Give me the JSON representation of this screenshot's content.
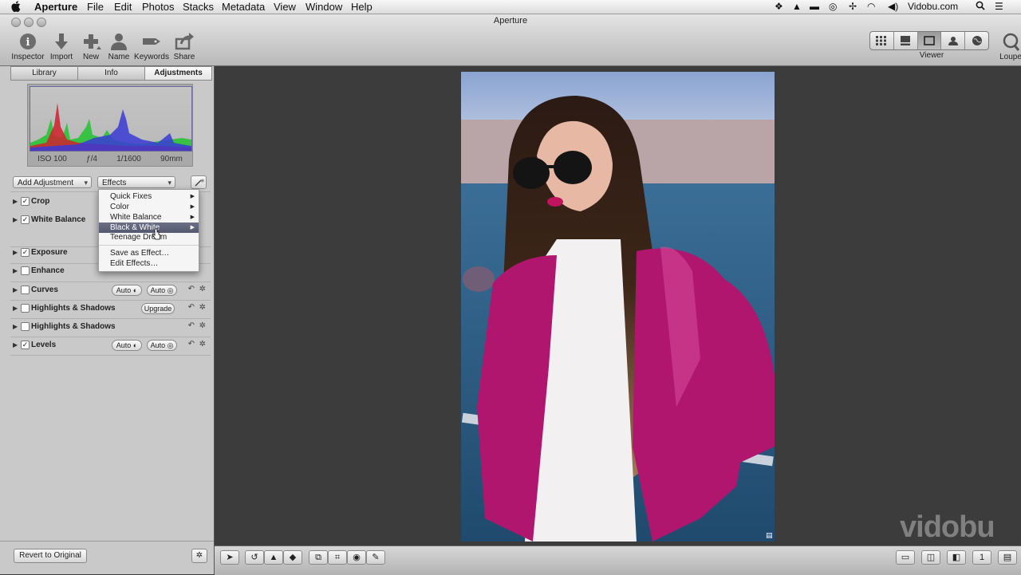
{
  "menubar": {
    "apple": "",
    "items": [
      "Aperture",
      "File",
      "Edit",
      "Photos",
      "Stacks",
      "Metadata",
      "View",
      "Window",
      "Help"
    ],
    "right_label": "Vidobu.com"
  },
  "window": {
    "title": "Aperture"
  },
  "toolbar": {
    "tools": [
      "Inspector",
      "Import",
      "New",
      "Name",
      "Keywords",
      "Share"
    ],
    "viewer_label": "Viewer",
    "loupe_label": "Loupe"
  },
  "inspector": {
    "tabs": [
      "Library",
      "Info",
      "Adjustments"
    ],
    "active_tab": "Adjustments",
    "histogram_meta": [
      "ISO 100",
      "ƒ/4",
      "1/1600",
      "90mm"
    ],
    "add_adjustment": "Add Adjustment",
    "effects": "Effects",
    "adjustments": [
      {
        "label": "Crop",
        "checked": true
      },
      {
        "label": "White Balance",
        "checked": true
      },
      {
        "label": "Exposure",
        "checked": true
      },
      {
        "label": "Enhance",
        "checked": false
      },
      {
        "label": "Curves",
        "checked": false
      },
      {
        "label": "Highlights & Shadows",
        "checked": false
      },
      {
        "label": "Highlights & Shadows",
        "checked": false
      },
      {
        "label": "Levels",
        "checked": true
      }
    ],
    "auto_label": "Auto",
    "upgrade_label": "Upgrade",
    "revert_label": "Revert to Original"
  },
  "effects_menu": {
    "items": [
      "Quick Fixes",
      "Color",
      "White Balance",
      "Black & White",
      "Teenage Dream",
      "Save as Effect…",
      "Edit Effects…"
    ],
    "highlighted": "Black & White"
  },
  "watermark": "vidobu",
  "colors": {
    "highlight": "#5c6177",
    "jacket": "#b0166e",
    "sky": "#8aa4d2",
    "sea": "#2e5a7e"
  }
}
